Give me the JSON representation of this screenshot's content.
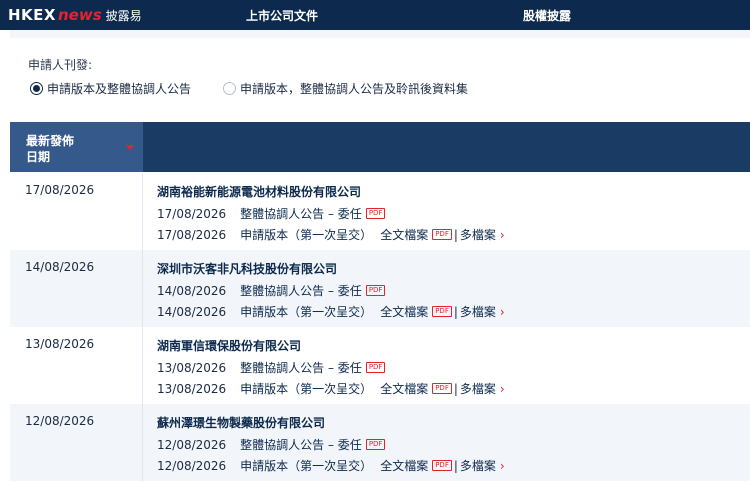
{
  "header": {
    "logo_hkex": "HKEX",
    "logo_news": "news",
    "logo_cn": "披露易",
    "nav": [
      "上市公司文件",
      "股權披露"
    ]
  },
  "filter": {
    "label": "申請人刊發:",
    "options": [
      {
        "label": "申請版本及整體協調人公告",
        "selected": true
      },
      {
        "label": "申請版本，整體協調人公告及聆訊後資料集",
        "selected": false
      }
    ]
  },
  "table": {
    "header_date": "最新發佈日期",
    "header_date_line1": "最新發佈",
    "header_date_line2": "日期",
    "pdf_badge": "PDF",
    "full_file": "全文檔案",
    "multi_file": "多檔案",
    "separator": "|",
    "rows": [
      {
        "date": "17/08/2026",
        "company": "湖南裕能新能源電池材料股份有限公司",
        "docs": [
          {
            "date": "17/08/2026",
            "title": "整體協調人公告 – 委任"
          },
          {
            "date": "17/08/2026",
            "title": "申請版本（第一次呈交）"
          }
        ]
      },
      {
        "date": "14/08/2026",
        "company": "深圳市沃客非凡科技股份有限公司",
        "docs": [
          {
            "date": "14/08/2026",
            "title": "整體協調人公告 – 委任"
          },
          {
            "date": "14/08/2026",
            "title": "申請版本（第一次呈交）"
          }
        ]
      },
      {
        "date": "13/08/2026",
        "company": "湖南軍信環保股份有限公司",
        "docs": [
          {
            "date": "13/08/2026",
            "title": "整體協調人公告 – 委任"
          },
          {
            "date": "13/08/2026",
            "title": "申請版本（第一次呈交）"
          }
        ]
      },
      {
        "date": "12/08/2026",
        "company": "蘇州澤璟生物製藥股份有限公司",
        "docs": [
          {
            "date": "12/08/2026",
            "title": "整體協調人公告 – 委任"
          },
          {
            "date": "12/08/2026",
            "title": "申請版本（第一次呈交）"
          }
        ]
      }
    ]
  },
  "colors": {
    "navy": "#0d2a4e",
    "header_bar": "#1a3b63",
    "header_date_cell": "#35598a",
    "accent_red": "#e5222f",
    "alt_row": "#f2f5f9"
  },
  "icons": {
    "sort": "sort-caret-down-icon",
    "pdf": "pdf-icon",
    "chevron": "chevron-right-icon"
  }
}
